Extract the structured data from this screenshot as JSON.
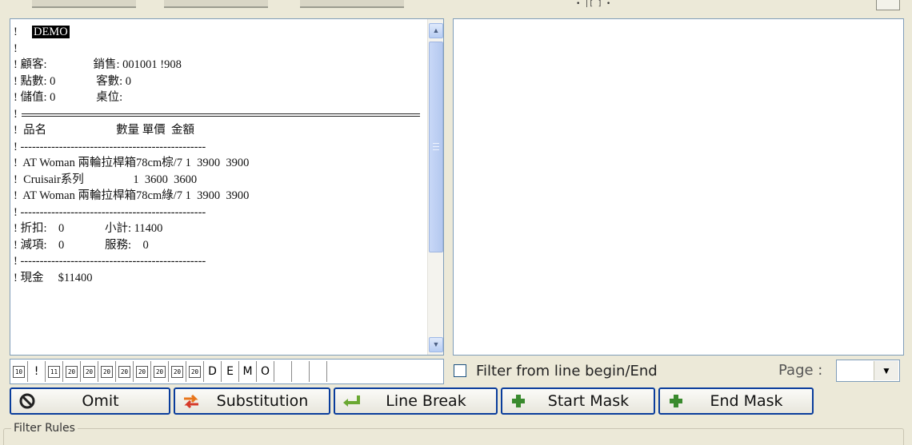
{
  "receipt": {
    "lines": [
      {
        "text": "!     DEMO",
        "style": "highlight",
        "hl": "DEMO"
      },
      {
        "text": "!",
        "style": "normal"
      },
      {
        "text": "! 顧客:                銷售: 001001 !908",
        "style": "normal"
      },
      {
        "text": "! 點數: 0              客數: 0",
        "style": "normal"
      },
      {
        "text": "! 儲值: 0              桌位:",
        "style": "normal"
      },
      {
        "text": "!",
        "style": "rule"
      },
      {
        "text": "!  品名                        數量 單價  金額",
        "style": "normal"
      },
      {
        "text": "! ------------------------------------------------",
        "style": "dash"
      },
      {
        "text": "!  AT Woman 兩輪拉桿箱78cm棕/7 1  3900  3900",
        "style": "normal"
      },
      {
        "text": "!  Cruisair系列                 1  3600  3600",
        "style": "normal"
      },
      {
        "text": "!  AT Woman 兩輪拉桿箱78cm綠/7 1  3900  3900",
        "style": "normal"
      },
      {
        "text": "! ------------------------------------------------",
        "style": "dash"
      },
      {
        "text": "! 折扣:    0              小計: 11400",
        "style": "normal"
      },
      {
        "text": "! 減項:    0              服務:    0",
        "style": "normal"
      },
      {
        "text": "! ------------------------------------------------",
        "style": "dash"
      },
      {
        "text": "! 現金     $11400",
        "style": "normal"
      }
    ]
  },
  "char_strip": {
    "cells": [
      {
        "kind": "tiny",
        "text": "10"
      },
      {
        "kind": "plain",
        "text": "!"
      },
      {
        "kind": "tiny",
        "text": "11"
      },
      {
        "kind": "tiny",
        "text": "20"
      },
      {
        "kind": "tiny",
        "text": "20"
      },
      {
        "kind": "tiny",
        "text": "20"
      },
      {
        "kind": "tiny",
        "text": "20"
      },
      {
        "kind": "tiny",
        "text": "20"
      },
      {
        "kind": "tiny",
        "text": "20"
      },
      {
        "kind": "tiny",
        "text": "20"
      },
      {
        "kind": "tiny",
        "text": "20"
      },
      {
        "kind": "plain",
        "text": "D"
      },
      {
        "kind": "plain",
        "text": "E"
      },
      {
        "kind": "plain",
        "text": "M"
      },
      {
        "kind": "plain",
        "text": "O"
      },
      {
        "kind": "plain",
        "text": ""
      },
      {
        "kind": "plain",
        "text": ""
      },
      {
        "kind": "plain",
        "text": ""
      }
    ]
  },
  "filter": {
    "checkbox_label": "Filter from line begin/End",
    "checked": false,
    "page_label": "Page :",
    "page_value": ""
  },
  "buttons": {
    "omit": "Omit",
    "substitution": "Substitution",
    "line_break": "Line Break",
    "start_mask": "Start Mask",
    "end_mask": "End Mask"
  },
  "groupbox": {
    "label": "Filter Rules"
  },
  "top_ruler": "• |[   ]   •",
  "colors": {
    "window_bg": "#ece9d8",
    "border": "#7f9db9",
    "button_border": "#0a3d9c",
    "scroll_thumb": "#b4c8ef"
  }
}
